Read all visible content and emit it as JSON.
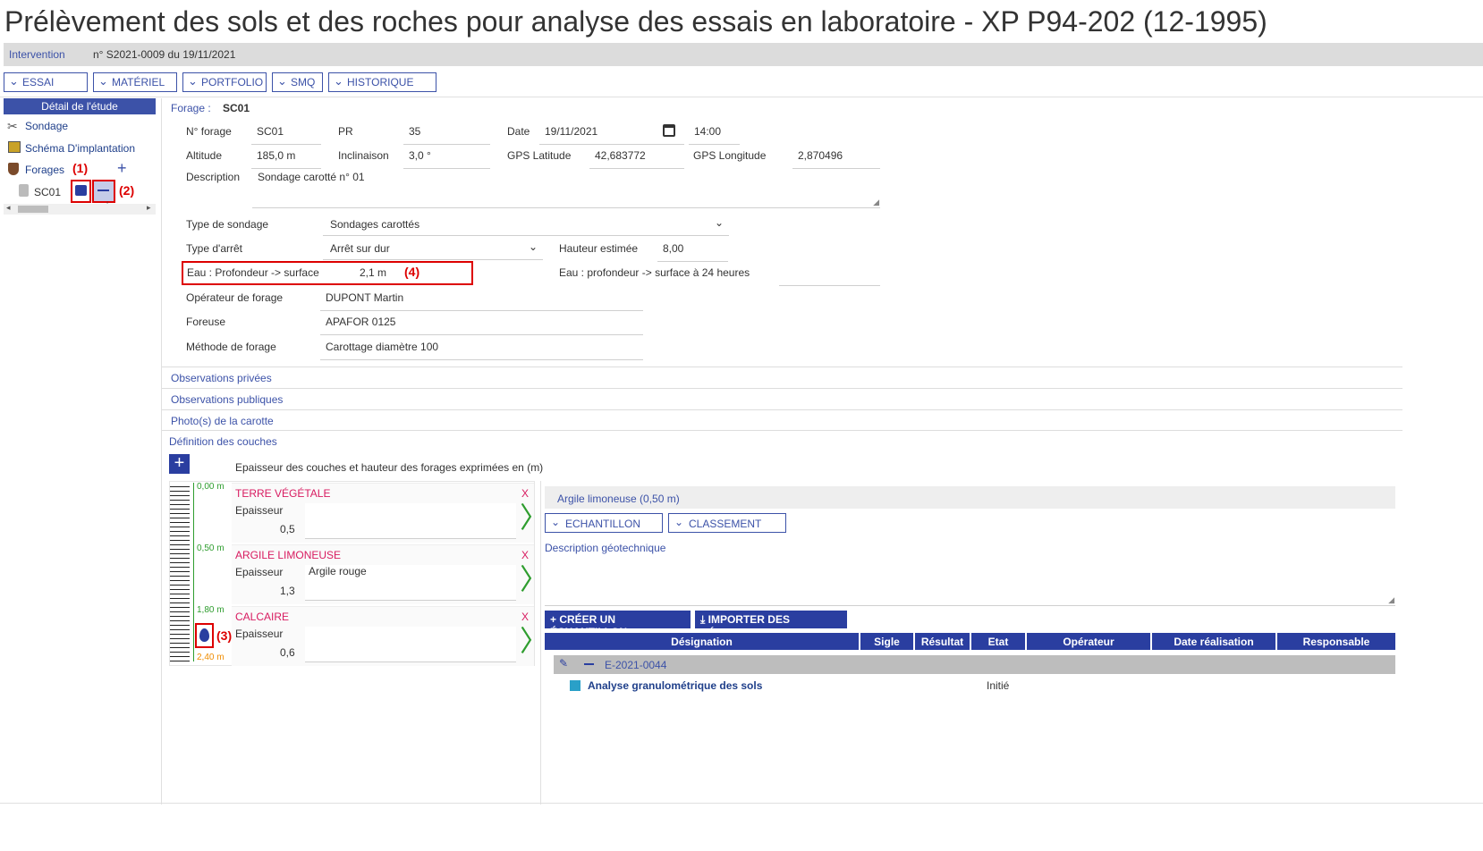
{
  "title": "Prélèvement des sols et des roches pour analyse des essais en laboratoire - XP P94-202 (12-1995)",
  "intervention": {
    "label": "Intervention",
    "value": "n° S2021-0009 du 19/11/2021"
  },
  "toolbar": [
    "ESSAI",
    "MATÉRIEL",
    "PORTFOLIO",
    "SMQ",
    "HISTORIQUE"
  ],
  "sidebar": {
    "header": "Détail de l'étude",
    "items": [
      "Sondage",
      "Schéma D'implantation",
      "Forages"
    ],
    "forage_item": "SC01"
  },
  "annotations": {
    "a1": "(1)",
    "a2": "(2)",
    "a3": "(3)",
    "a4": "(4)"
  },
  "form": {
    "forage_label": "Forage :",
    "forage_value": "SC01",
    "num_forage_label": "N° forage",
    "num_forage": "SC01",
    "pr_label": "PR",
    "pr": "35",
    "date_label": "Date",
    "date": "19/11/2021",
    "time": "14:00",
    "altitude_label": "Altitude",
    "altitude": "185,0 m",
    "inclinaison_label": "Inclinaison",
    "inclinaison": "3,0 °",
    "gps_lat_label": "GPS Latitude",
    "gps_lat": "42,683772",
    "gps_lon_label": "GPS Longitude",
    "gps_lon": "2,870496",
    "description_label": "Description",
    "description": "Sondage carotté n° 01",
    "type_sondage_label": "Type de sondage",
    "type_sondage": "Sondages carottés",
    "type_arret_label": "Type d'arrêt",
    "type_arret": "Arrêt sur dur",
    "hauteur_label": "Hauteur estimée",
    "hauteur": "8,00",
    "eau_label": "Eau : Profondeur -> surface",
    "eau": "2,1 m",
    "eau24_label": "Eau : profondeur -> surface à 24 heures",
    "eau24": "",
    "operateur_label": "Opérateur de forage",
    "operateur": "DUPONT Martin",
    "foreuse_label": "Foreuse",
    "foreuse": "APAFOR 0125",
    "methode_label": "Méthode de forage",
    "methode": "Carottage diamètre 100"
  },
  "accordions": [
    "Observations privées",
    "Observations publiques",
    "Photo(s) de la carotte",
    "Définition des couches"
  ],
  "couches": {
    "caption": "Epaisseur des couches et hauteur des forages exprimées en (m)",
    "depths": [
      "0,00 m",
      "0,50 m",
      "1,80 m",
      "2,40 m"
    ],
    "layers": [
      {
        "name": "TERRE VÉGÉTALE",
        "ep_label": "Epaisseur",
        "ep": "0,5",
        "desc": ""
      },
      {
        "name": "ARGILE LIMONEUSE",
        "ep_label": "Epaisseur",
        "ep": "1,3",
        "desc": "Argile rouge"
      },
      {
        "name": "CALCAIRE",
        "ep_label": "Epaisseur",
        "ep": "0,6",
        "desc": ""
      }
    ],
    "close": "X"
  },
  "detail": {
    "header": "Argile limoneuse (0,50 m)",
    "buttons": [
      "ECHANTILLON",
      "CLASSEMENT"
    ],
    "desc_label": "Description géotechnique",
    "create_btn": "CRÉER UN ÉCHANTILLON",
    "import_btn": "IMPORTER DES RÉSULTATS",
    "columns": [
      "Désignation",
      "Sigle",
      "Résultat",
      "Etat",
      "Opérateur",
      "Date réalisation",
      "Responsable validation"
    ],
    "group": "E-2021-0044",
    "row": {
      "designation": "Analyse granulométrique des sols",
      "etat": "Initié"
    }
  }
}
